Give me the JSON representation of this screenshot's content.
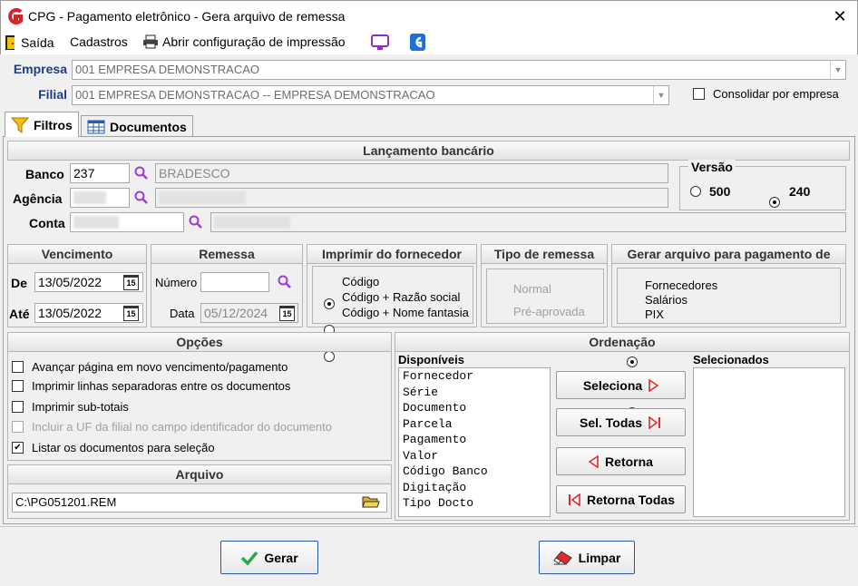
{
  "window": {
    "title": "CPG -  Pagamento eletrônico - Gera arquivo de remessa",
    "close": "✕"
  },
  "menu": {
    "saida": "Saída",
    "cadastros": "Cadastros",
    "imprimir": "Abrir configuração de impressão"
  },
  "empresa": {
    "label": "Empresa",
    "value": "001 EMPRESA DEMONSTRACAO"
  },
  "filial": {
    "label": "Filial",
    "value": "001 EMPRESA DEMONSTRACAO -- EMPRESA DEMONSTRACAO"
  },
  "consolidar": {
    "label": "Consolidar por empresa",
    "checked": false
  },
  "tabs": [
    {
      "label": "Filtros"
    },
    {
      "label": "Documentos"
    }
  ],
  "lancamento": {
    "header": "Lançamento bancário",
    "banco_label": "Banco",
    "banco_code": "237",
    "banco_name": "BRADESCO",
    "agencia_label": "Agência",
    "conta_label": "Conta"
  },
  "versao": {
    "label": "Versão",
    "opt1": "500",
    "opt2": "240",
    "selected": "240"
  },
  "vencimento": {
    "header": "Vencimento",
    "de_label": "De",
    "de_value": "13/05/2022",
    "ate_label": "Até",
    "ate_value": "13/05/2022",
    "cal_icon": "15"
  },
  "remessa": {
    "header": "Remessa",
    "numero_label": "Número",
    "numero_value": "",
    "data_label": "Data",
    "data_value": "05/12/2024",
    "cal_icon": "15"
  },
  "imprimir": {
    "header": "Imprimir do fornecedor",
    "opt1": "Código",
    "opt2": "Código + Razão social",
    "opt3": "Código + Nome fantasia",
    "selected": "Código"
  },
  "tipo_remessa": {
    "header": "Tipo de remessa",
    "opt1": "Normal",
    "opt2": "Pré-aprovada"
  },
  "gerar_arquivo": {
    "header": "Gerar arquivo para pagamento de",
    "opt1": "Fornecedores",
    "opt2": "Salários",
    "opt3": "PIX",
    "selected": "Fornecedores"
  },
  "opcoes": {
    "header": "Opções",
    "items": [
      {
        "label": "Avançar página em novo vencimento/pagamento",
        "checked": false,
        "disabled": false
      },
      {
        "label": "Imprimir linhas separadoras entre os documentos",
        "checked": false,
        "disabled": false
      },
      {
        "label": "Imprimir sub-totais",
        "checked": false,
        "disabled": false
      },
      {
        "label": "Incluir a UF da filial no campo identificador do documento",
        "checked": false,
        "disabled": true
      },
      {
        "label": "Listar os documentos para seleção",
        "checked": true,
        "disabled": false
      }
    ]
  },
  "arquivo": {
    "header": "Arquivo",
    "value": "C:\\PG051201.REM"
  },
  "ordenacao": {
    "header": "Ordenação",
    "disponiveis_label": "Disponíveis",
    "selecionados_label": "Selecionados",
    "disponiveis": [
      "Fornecedor",
      "Série",
      "Documento",
      "Parcela",
      "Pagamento",
      "Valor",
      "Código Banco",
      "Digitação",
      "Tipo Docto"
    ],
    "selecionados": [],
    "btn_seleciona": "Seleciona",
    "btn_sel_todas": "Sel. Todas",
    "btn_retorna": "Retorna",
    "btn_retorna_todas": "Retorna Todas"
  },
  "footer": {
    "gerar": "Gerar",
    "limpar": "Limpar"
  },
  "colors": {
    "label_blue": "#1f3c8a",
    "accent_red": "#e0282e",
    "magnifier": "#9a3fd0"
  }
}
